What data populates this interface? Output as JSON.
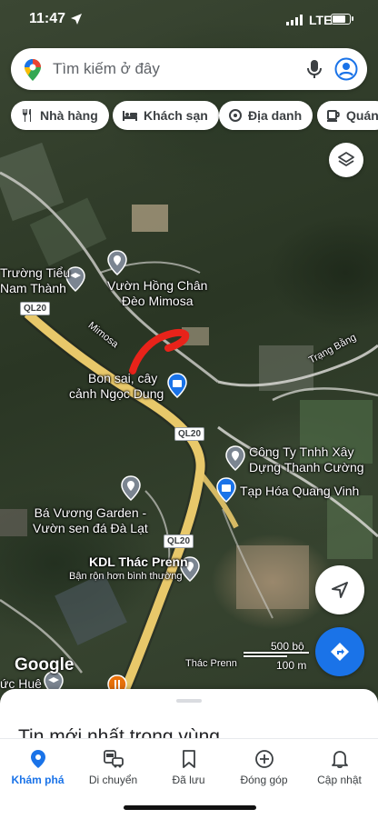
{
  "status_bar": {
    "time": "11:47",
    "carrier": "LTE"
  },
  "search": {
    "placeholder": "Tìm kiếm ở đây"
  },
  "chips": [
    {
      "label": "Nhà hàng",
      "icon": "fork-knife-icon"
    },
    {
      "label": "Khách sạn",
      "icon": "bed-icon"
    },
    {
      "label": "Địa danh",
      "icon": "landmark-icon"
    },
    {
      "label": "Quán",
      "icon": "coffee-cup-icon"
    }
  ],
  "map": {
    "labels": {
      "school_line1": "Trường Tiểu",
      "school_line2": "Nam Thành",
      "garden_line1": "Vườn Hồng Chân",
      "garden_line2": "Đèo Mimosa",
      "street_mimosa": "Mimosa",
      "bonsai_line1": "Bon sai, cây",
      "bonsai_line2": "cảnh Ngọc Dung",
      "street_trang_bang": "Trạng Bằng",
      "company_line1": "Công Ty Tnhh Xây",
      "company_line2": "Dựng Thanh Cường",
      "grocery": "Tạp Hóa Quang Vinh",
      "bavuong_line1": "Bá Vương Garden -",
      "bavuong_line2": "Vườn sen đá Đà Lạt",
      "waterfall_title": "KDL Thác Prenn",
      "waterfall_status": "Bận rộn hơn bình thường",
      "waterfall_small": "Thác Prenn",
      "hue_partial": "ức Huệ",
      "road_ql20_a": "QL20",
      "road_ql20_b": "QL20",
      "road_ql20_c": "QL20"
    },
    "google": "Google",
    "scale_ft": "500 bộ",
    "scale_m": "100 m"
  },
  "sheet": {
    "title": "Tin mới nhất trong vùng"
  },
  "tabs": [
    {
      "label": "Khám phá",
      "icon": "explore-pin-icon",
      "active": true
    },
    {
      "label": "Di chuyển",
      "icon": "commute-icon",
      "active": false
    },
    {
      "label": "Đã lưu",
      "icon": "bookmark-icon",
      "active": false
    },
    {
      "label": "Đóng góp",
      "icon": "add-circle-icon",
      "active": false
    },
    {
      "label": "Cập nhật",
      "icon": "bell-icon",
      "active": false
    }
  ],
  "colors": {
    "accent": "#1a73e8",
    "road": "#e8c86a",
    "annotation": "#e8231a"
  }
}
